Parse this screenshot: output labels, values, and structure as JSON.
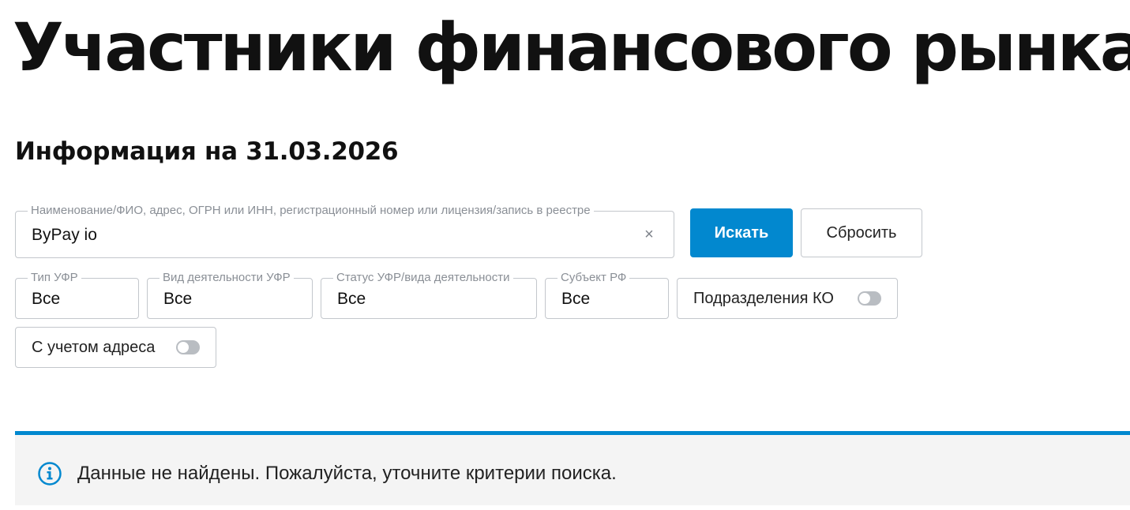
{
  "page": {
    "title": "Участники финансового рынка",
    "info_date": "Информация на 31.03.2026"
  },
  "search": {
    "label": "Наименование/ФИО, адрес, ОГРН или ИНН, регистрационный номер или лицензия/запись в реестре",
    "value": "ByPay io",
    "clear_icon": "×",
    "search_label": "Искать",
    "reset_label": "Сбросить"
  },
  "filters": {
    "type": {
      "label": "Тип УФР",
      "value": "Все"
    },
    "activity": {
      "label": "Вид деятельности УФР",
      "value": "Все"
    },
    "status": {
      "label": "Статус УФР/вида деятельности",
      "value": "Все"
    },
    "region": {
      "label": "Субъект РФ",
      "value": "Все"
    }
  },
  "toggles": {
    "branches": {
      "label": "Подразделения КО",
      "on": false
    },
    "address": {
      "label": "С учетом адреса",
      "on": false
    }
  },
  "notice": {
    "text": "Данные не найдены. Пожалуйста, уточните критерии поиска.",
    "icon": "info-icon"
  },
  "colors": {
    "accent": "#0288cf",
    "border": "#c3c7cc",
    "notice_bg": "#f4f4f4",
    "toggle_off": "#b9bdc2"
  }
}
